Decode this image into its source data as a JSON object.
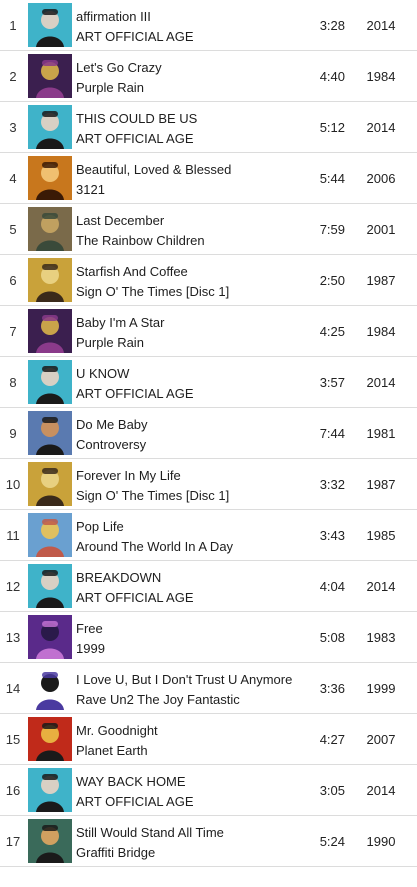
{
  "tracks": [
    {
      "num": "1",
      "title": "affirmation III",
      "album": "ART OFFICIAL AGE",
      "duration": "3:28",
      "year": "2014",
      "art": "art-official-age",
      "colors": [
        "#3fb3c9",
        "#1a1a1a",
        "#d8d0c4"
      ]
    },
    {
      "num": "2",
      "title": "Let's Go Crazy",
      "album": "Purple Rain",
      "duration": "4:40",
      "year": "1984",
      "art": "purple-rain",
      "colors": [
        "#3b1f4f",
        "#8a3a8a",
        "#c9a34a"
      ]
    },
    {
      "num": "3",
      "title": "THIS COULD BE US",
      "album": "ART OFFICIAL AGE",
      "duration": "5:12",
      "year": "2014",
      "art": "art-official-age",
      "colors": [
        "#3fb3c9",
        "#1a1a1a",
        "#d8d0c4"
      ]
    },
    {
      "num": "4",
      "title": "Beautiful, Loved & Blessed",
      "album": "3121",
      "duration": "5:44",
      "year": "2006",
      "art": "3121",
      "colors": [
        "#c8771d",
        "#3a1a06",
        "#f0c070"
      ]
    },
    {
      "num": "5",
      "title": "Last December",
      "album": "The Rainbow Children",
      "duration": "7:59",
      "year": "2001",
      "art": "rainbow-children",
      "colors": [
        "#7a6a4a",
        "#3a4a3a",
        "#c0a060"
      ]
    },
    {
      "num": "6",
      "title": "Starfish And Coffee",
      "album": "Sign O' The Times [Disc 1]",
      "duration": "2:50",
      "year": "1987",
      "art": "sign-o-the-times",
      "colors": [
        "#c9a23a",
        "#3a2a1a",
        "#e8d080"
      ]
    },
    {
      "num": "7",
      "title": "Baby I'm A Star",
      "album": "Purple Rain",
      "duration": "4:25",
      "year": "1984",
      "art": "purple-rain",
      "colors": [
        "#3b1f4f",
        "#8a3a8a",
        "#c9a34a"
      ]
    },
    {
      "num": "8",
      "title": "U KNOW",
      "album": "ART OFFICIAL AGE",
      "duration": "3:57",
      "year": "2014",
      "art": "art-official-age",
      "colors": [
        "#3fb3c9",
        "#1a1a1a",
        "#d8d0c4"
      ]
    },
    {
      "num": "9",
      "title": "Do Me Baby",
      "album": "Controversy",
      "duration": "7:44",
      "year": "1981",
      "art": "controversy",
      "colors": [
        "#5a7ab0",
        "#1a1a1a",
        "#c89060"
      ]
    },
    {
      "num": "10",
      "title": "Forever In My Life",
      "album": "Sign O' The Times [Disc 1]",
      "duration": "3:32",
      "year": "1987",
      "art": "sign-o-the-times",
      "colors": [
        "#c9a23a",
        "#3a2a1a",
        "#e8d080"
      ]
    },
    {
      "num": "11",
      "title": "Pop Life",
      "album": "Around The World In A Day",
      "duration": "3:43",
      "year": "1985",
      "art": "around-the-world",
      "colors": [
        "#6aa0d0",
        "#c05a4a",
        "#e0c060"
      ]
    },
    {
      "num": "12",
      "title": "BREAKDOWN",
      "album": "ART OFFICIAL AGE",
      "duration": "4:04",
      "year": "2014",
      "art": "art-official-age",
      "colors": [
        "#3fb3c9",
        "#1a1a1a",
        "#d8d0c4"
      ]
    },
    {
      "num": "13",
      "title": "Free",
      "album": "1999",
      "duration": "5:08",
      "year": "1983",
      "art": "1999",
      "colors": [
        "#5a2a8a",
        "#c070d0",
        "#2a1a4a"
      ]
    },
    {
      "num": "14",
      "title": "I Love U, But I Don't Trust U Anymore",
      "album": "Rave Un2 The Joy Fantastic",
      "duration": "3:36",
      "year": "1999",
      "art": "rave-un2",
      "colors": [
        "#ffffff",
        "#4a3aa0",
        "#1a1a1a"
      ]
    },
    {
      "num": "15",
      "title": "Mr. Goodnight",
      "album": "Planet Earth",
      "duration": "4:27",
      "year": "2007",
      "art": "planet-earth",
      "colors": [
        "#c02a1a",
        "#1a1a1a",
        "#e8b040"
      ]
    },
    {
      "num": "16",
      "title": "WAY BACK HOME",
      "album": "ART OFFICIAL AGE",
      "duration": "3:05",
      "year": "2014",
      "art": "art-official-age",
      "colors": [
        "#3fb3c9",
        "#1a1a1a",
        "#d8d0c4"
      ]
    },
    {
      "num": "17",
      "title": "Still Would Stand All Time",
      "album": "Graffiti Bridge",
      "duration": "5:24",
      "year": "1990",
      "art": "graffiti-bridge",
      "colors": [
        "#3a6a5a",
        "#1a1a1a",
        "#d0a060"
      ]
    }
  ]
}
